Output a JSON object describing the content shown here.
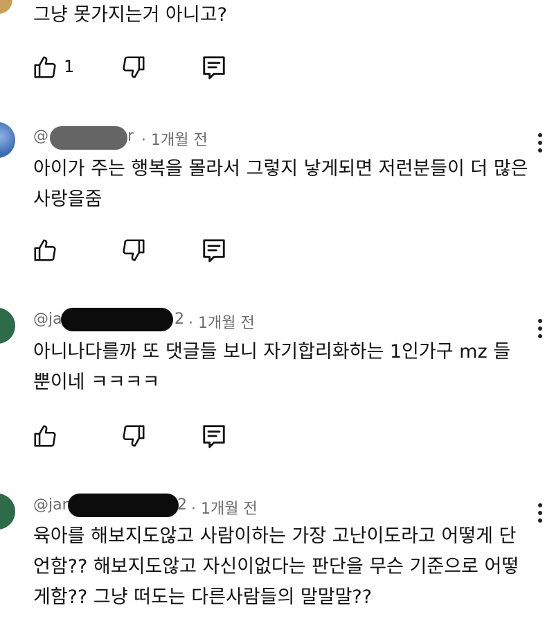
{
  "colors": {
    "background": "#ffffff",
    "text": "#111111",
    "meta_text": "#6b6b6b",
    "avatar_blue": "#3f6fb6",
    "avatar_green": "#2e6b48"
  },
  "top_comment": {
    "text": "그냥 못가지는거 아니고?",
    "like_count": "1"
  },
  "comments": [
    {
      "handle": "@",
      "handle_end": "r",
      "time": "1개월 전",
      "text": "아이가 주는 행복을 몰라서 그렇지 낳게되면 저런분들이 더 많은 사랑을줌",
      "avatar_icon": "user-avatar-icon"
    },
    {
      "handle": "@ja",
      "handle_end": "2",
      "time": "1개월 전",
      "text": "아니나다를까 또 댓글들 보니 자기합리화하는 1인가구 mz 들 뿐이네 ㅋㅋㅋㅋ",
      "avatar_icon": "user-avatar-icon"
    },
    {
      "handle": "@jan",
      "handle_end": "2",
      "time": "1개월 전",
      "text": "육아를 해보지도않고 사람이하는 가장 고난이도라고 어떻게 단언함?? 해보지도않고 자신이없다는 판단을 무슨 기준으로 어떻게함?? 그냥 떠도는  다른사람들의 말말말??",
      "avatar_icon": "user-avatar-icon"
    }
  ],
  "icons": {
    "like": "thumbs-up-icon",
    "dislike": "thumbs-down-icon",
    "reply": "reply-comment-icon",
    "more": "more-vertical-icon"
  }
}
